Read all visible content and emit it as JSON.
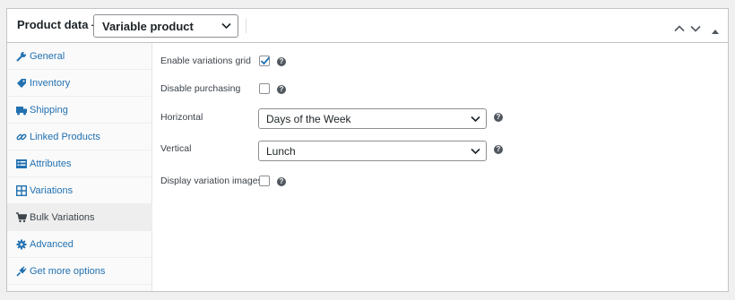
{
  "header": {
    "title": "Product data —",
    "product_type": "Variable product",
    "icons": [
      "chevron-down-icon",
      "move-up-icon",
      "move-down-icon",
      "toggle-panel-arrow-icon"
    ]
  },
  "tabs": [
    {
      "label": "General",
      "icon": "wrench-icon",
      "active": false
    },
    {
      "label": "Inventory",
      "icon": "tag-icon",
      "active": false
    },
    {
      "label": "Shipping",
      "icon": "truck-icon",
      "active": false
    },
    {
      "label": "Linked Products",
      "icon": "link-icon",
      "active": false
    },
    {
      "label": "Attributes",
      "icon": "list-icon",
      "active": false
    },
    {
      "label": "Variations",
      "icon": "grid-icon",
      "active": false
    },
    {
      "label": "Bulk Variations",
      "icon": "cart-icon",
      "active": true
    },
    {
      "label": "Advanced",
      "icon": "gear-icon",
      "active": false
    },
    {
      "label": "Get more options",
      "icon": "plugin-icon",
      "active": false
    }
  ],
  "options": {
    "enable_grid": {
      "label": "Enable variations grid",
      "checked": true
    },
    "disable_purchasing": {
      "label": "Disable purchasing",
      "checked": false
    },
    "horizontal": {
      "label": "Horizontal",
      "value": "Days of the Week"
    },
    "vertical": {
      "label": "Vertical",
      "value": "Lunch"
    },
    "display_images": {
      "label": "Display variation images",
      "checked": false
    }
  },
  "help_glyph": "?",
  "colors": {
    "link": "#2271b1",
    "accent": "#2271b1",
    "border": "#c3c4c7",
    "active_tab_bg": "#eeeeee"
  }
}
